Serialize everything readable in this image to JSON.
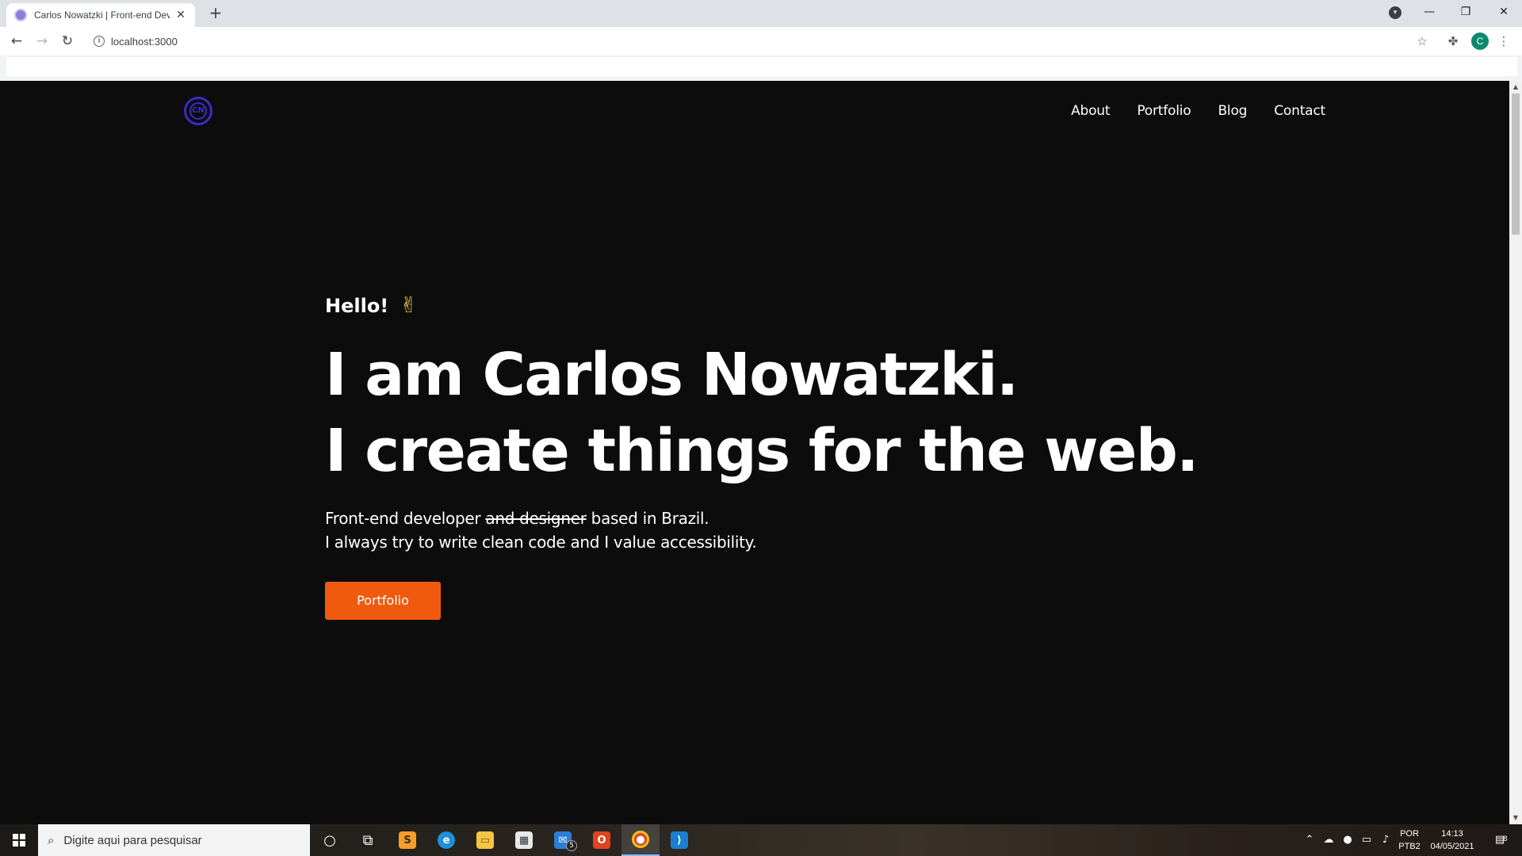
{
  "browser": {
    "tab_title": "Carlos Nowatzki | Front-end Developer",
    "tab_close": "✕",
    "new_tab": "+",
    "url": "localhost:3000",
    "profile_initial": "C",
    "icons": [
      "back-arrow-icon",
      "forward-arrow-icon",
      "reload-icon",
      "info-icon",
      "star-icon",
      "extensions-icon",
      "menu-icon"
    ]
  },
  "site": {
    "logo_text": "CN",
    "nav": [
      {
        "label": "About"
      },
      {
        "label": "Portfolio"
      },
      {
        "label": "Blog"
      },
      {
        "label": "Contact"
      }
    ],
    "hero": {
      "greeting": "Hello!",
      "greeting_emoji": "✌",
      "headline_line1": "I am Carlos Nowatzki.",
      "headline_line2": "I create things for the web.",
      "desc_prefix": "Front-end developer ",
      "desc_struck": "and designer",
      "desc_suffix": " based in Brazil.",
      "desc_line2": "I always try to write clean code and I value accessibility.",
      "cta_label": "Portfolio"
    },
    "colors": {
      "background": "#0c0c0c",
      "accent": "#f05a0f",
      "logo": "#3b2bc9",
      "text": "#ffffff"
    }
  },
  "taskbar": {
    "search_placeholder": "Digite aqui para pesquisar",
    "mail_badge": "5",
    "language_line1": "POR",
    "language_line2": "PTB2",
    "time": "14:13",
    "date": "04/05/2021",
    "notification_count": "8"
  }
}
